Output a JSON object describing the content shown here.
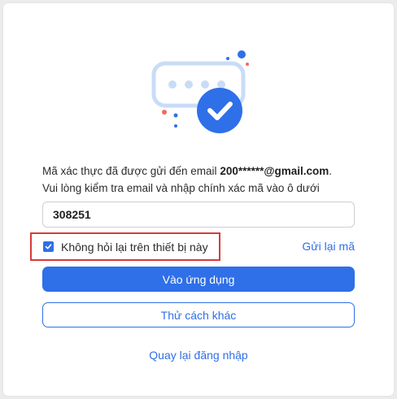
{
  "verify": {
    "message_prefix": "Mã xác thực đã được gửi đến email ",
    "masked_email": "200******@gmail.com",
    "message_suffix": ".",
    "message_line2": "Vui lòng kiểm tra email và nhập chính xác mã vào ô dưới",
    "otp_value": "308251",
    "remember_checked": true,
    "remember_label": "Không hỏi lại trên thiết bị này",
    "resend_label": "Gửi lại mã",
    "primary_label": "Vào ứng dụng",
    "secondary_label": "Thử cách khác",
    "back_label": "Quay lại đăng nhập"
  },
  "colors": {
    "accent": "#2f6fe8",
    "highlight_border": "#d9393b",
    "illustration_light": "#c9dcf7",
    "dot_red": "#f06a5f"
  },
  "icons": {
    "illustration": "password-bubble-check-illustration",
    "checkbox": "checkmark-icon"
  }
}
